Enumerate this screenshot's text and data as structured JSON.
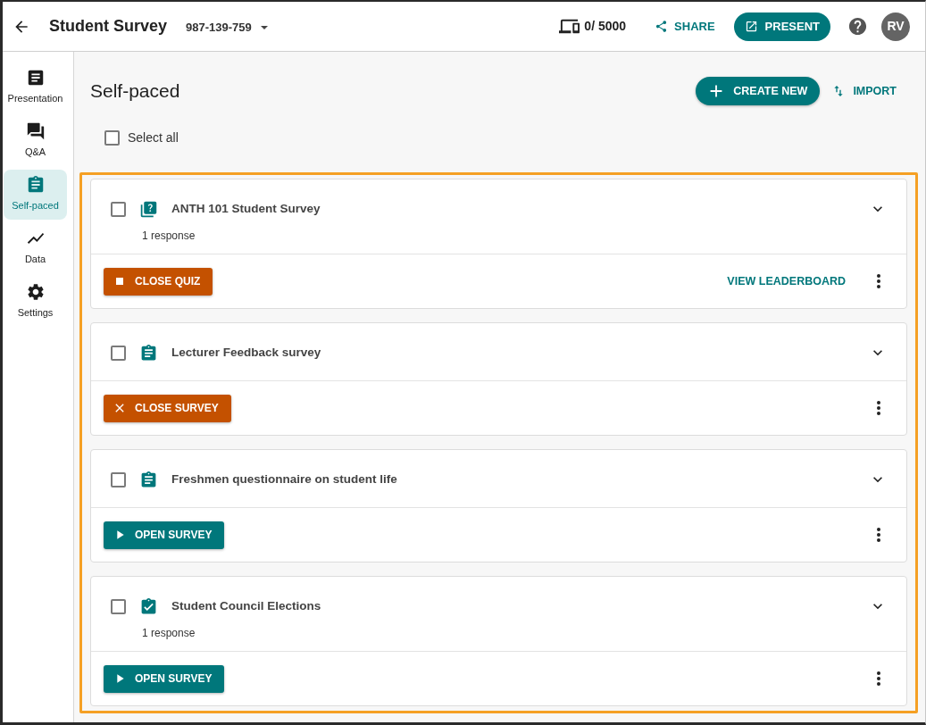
{
  "header": {
    "title": "Student Survey",
    "session_code": "987-139-759",
    "participants": "0/ 5000",
    "share_label": "SHARE",
    "present_label": "PRESENT",
    "avatar_initials": "RV"
  },
  "sidebar": {
    "items": [
      {
        "label": "Presentation",
        "selected": false
      },
      {
        "label": "Q&A",
        "selected": false
      },
      {
        "label": "Self-paced",
        "selected": true
      },
      {
        "label": "Data",
        "selected": false
      },
      {
        "label": "Settings",
        "selected": false
      }
    ]
  },
  "main": {
    "title": "Self-paced",
    "create_label": "CREATE NEW",
    "import_label": "IMPORT",
    "select_all": {
      "label": "Select all",
      "checked": false
    },
    "activities": [
      {
        "kind": "quiz",
        "title": "ANTH 101 Student Survey",
        "checked": false,
        "expanded": false,
        "responses": "1 response",
        "action": {
          "kind": "stop",
          "label": "CLOSE QUIZ"
        },
        "link": "VIEW LEADERBOARD"
      },
      {
        "kind": "survey",
        "title": "Lecturer Feedback survey",
        "checked": false,
        "expanded": false,
        "action": {
          "kind": "close",
          "label": "CLOSE SURVEY"
        }
      },
      {
        "kind": "survey",
        "title": "Freshmen questionnaire on student life",
        "checked": false,
        "expanded": false,
        "action": {
          "kind": "open",
          "label": "OPEN SURVEY"
        }
      },
      {
        "kind": "completed",
        "title": "Student Council Elections",
        "checked": false,
        "expanded": false,
        "responses": "1 response",
        "action": {
          "kind": "open",
          "label": "OPEN SURVEY"
        }
      }
    ]
  }
}
